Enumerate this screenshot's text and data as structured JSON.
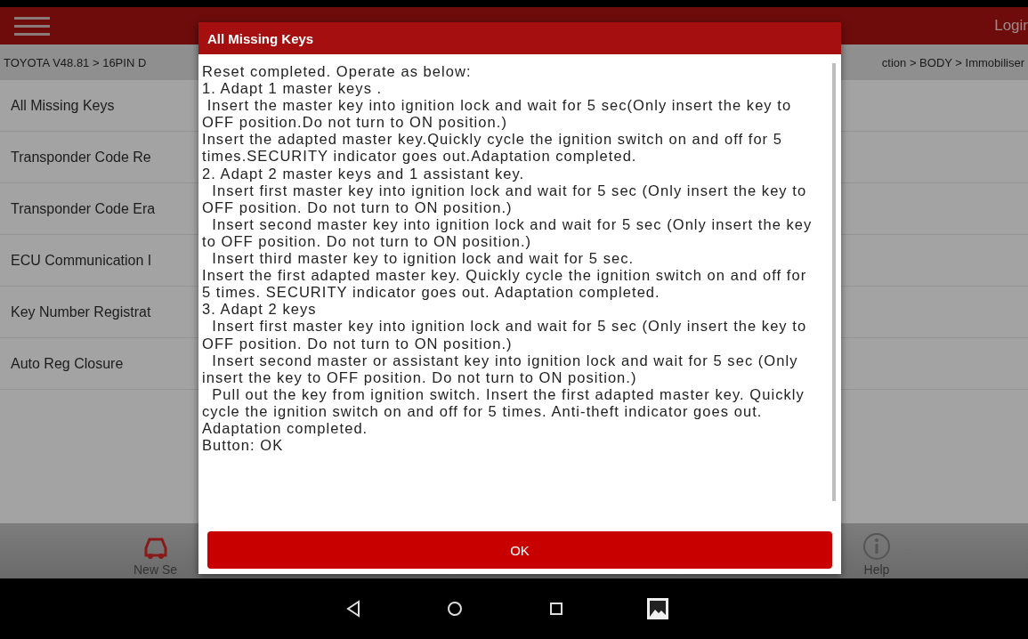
{
  "header": {
    "login": "Logir"
  },
  "breadcrumb": {
    "left": "TOYOTA V48.81 > 16PIN D",
    "right": "ction > BODY > Immobiliser"
  },
  "menu_items": [
    {
      "label": "All Missing Keys"
    },
    {
      "label": "Transponder Code Re"
    },
    {
      "label": "Transponder Code Era"
    },
    {
      "label": "ECU Communication I"
    },
    {
      "label": "Key Number Registrat"
    },
    {
      "label": "Auto Reg Closure"
    }
  ],
  "toolbar": [
    {
      "kind": "car",
      "label": "New Se"
    },
    {
      "kind": "help",
      "label": "Help"
    }
  ],
  "dialog": {
    "title": "All Missing Keys",
    "lines": [
      "Reset completed. Operate as below:",
      "1. Adapt 1 master keys .",
      " Insert the master key into ignition lock and wait for 5 sec(Only insert the key to",
      "OFF position.Do not turn to ON position.)",
      "Insert the adapted master key.Quickly cycle the ignition switch on and off for 5",
      "times.SECURITY indicator goes out.Adaptation completed.",
      "2. Adapt 2 master keys and 1 assistant key.",
      "  Insert first master key into ignition lock and wait for 5 sec (Only insert the key to",
      "OFF position. Do not turn to ON position.)",
      "  Insert second master key into ignition lock and wait for 5 sec (Only insert the key",
      "to OFF position. Do not turn to ON position.)",
      "  Insert third master key to ignition lock and wait for 5 sec.",
      "Insert the first adapted master key. Quickly cycle the ignition switch on and off for",
      "5 times. SECURITY indicator goes out. Adaptation completed.",
      "3. Adapt 2 keys",
      "  Insert first master key into ignition lock and wait for 5 sec (Only insert the key to",
      "OFF position. Do not turn to ON position.)",
      "  Insert second master or assistant key into ignition lock and wait for 5 sec (Only",
      "insert the key to OFF position. Do not turn to ON position.)",
      "  Pull out the key from ignition switch. Insert the first adapted master key. Quickly",
      "cycle the ignition switch on and off for 5 times. Anti-theft indicator goes out.",
      "Adaptation completed.",
      "Button: OK"
    ],
    "button": "OK"
  },
  "nav_bar": [
    {
      "kind": "back"
    },
    {
      "kind": "home"
    },
    {
      "kind": "recents"
    },
    {
      "kind": "gallery"
    }
  ]
}
